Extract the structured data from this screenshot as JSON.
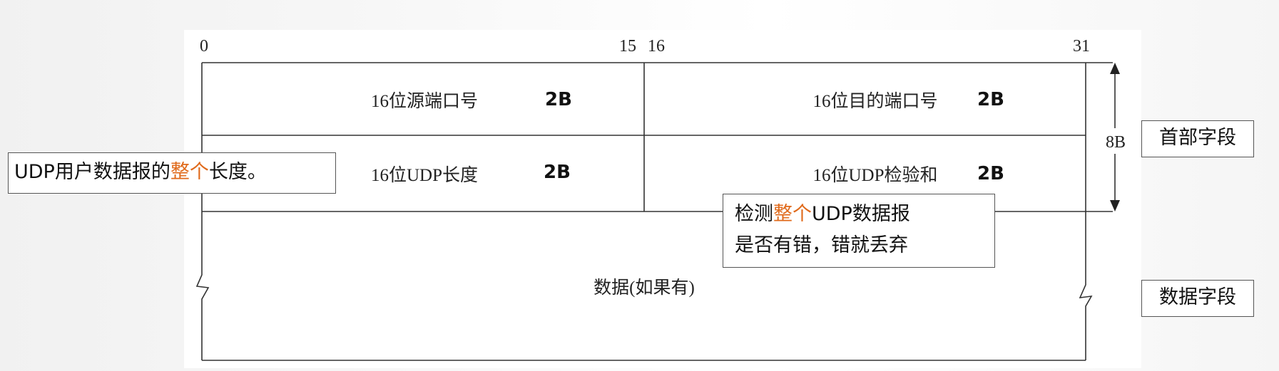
{
  "bit_labels": {
    "start": "0",
    "mid_left": "15",
    "mid_right": "16",
    "end": "31"
  },
  "rows": [
    {
      "left_field": "16位源端口号",
      "left_size": "2B",
      "right_field": "16位目的端口号",
      "right_size": "2B"
    },
    {
      "left_field": "16位UDP长度",
      "left_size": "2B",
      "right_field": "16位UDP检验和",
      "right_size": "2B"
    }
  ],
  "data_area": {
    "label": "数据(如果有)"
  },
  "header_size": "8B",
  "side_labels": {
    "header": "首部字段",
    "data": "数据字段"
  },
  "callouts": {
    "length_note": {
      "prefix": "UDP用户数据报的",
      "highlight": "整个",
      "suffix": "长度。"
    },
    "checksum_note": {
      "line1_prefix": "检测",
      "line1_highlight": "整个",
      "line1_suffix": "UDP数据报",
      "line2": "是否有错，错就丢弃"
    }
  },
  "colors": {
    "highlight": "#e06a1b",
    "line": "#333333"
  }
}
